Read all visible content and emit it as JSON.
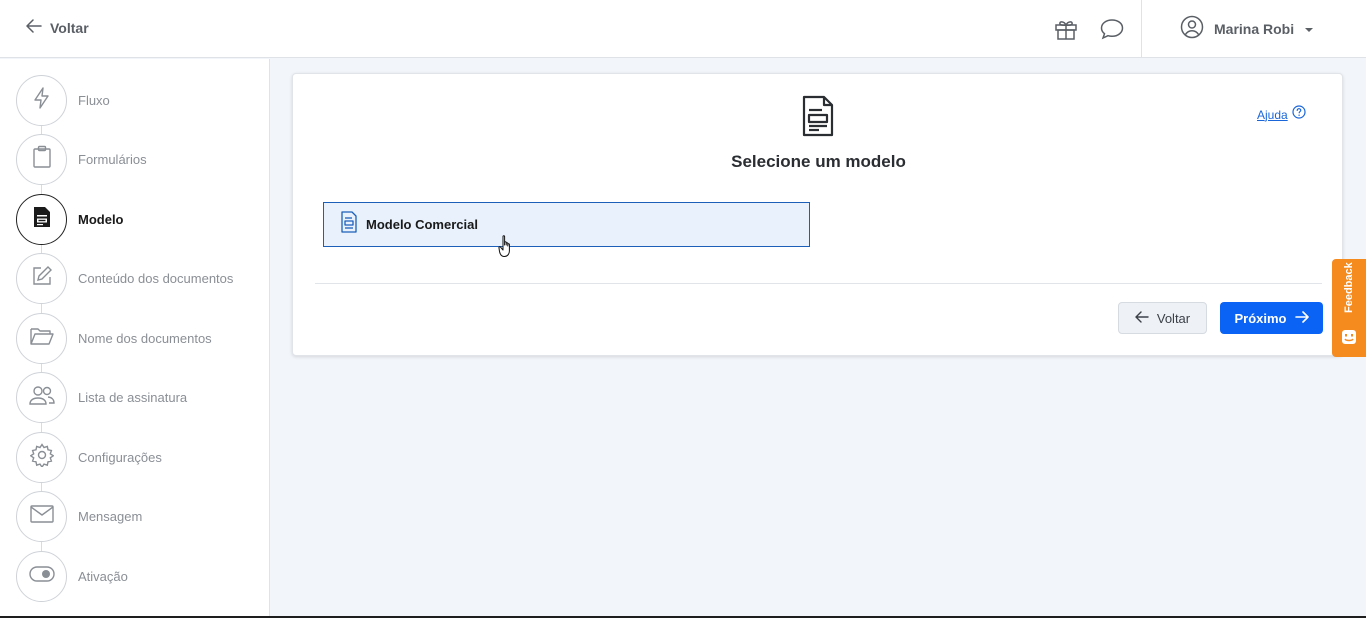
{
  "header": {
    "back_label": "Voltar",
    "user_name": "Marina Robi"
  },
  "steps": [
    {
      "label": "Fluxo",
      "icon": "lightning-icon",
      "active": false
    },
    {
      "label": "Formulários",
      "icon": "clipboard-icon",
      "active": false
    },
    {
      "label": "Modelo",
      "icon": "document-icon",
      "active": true
    },
    {
      "label": "Conteúdo dos documentos",
      "icon": "edit-icon",
      "active": false
    },
    {
      "label": "Nome dos documentos",
      "icon": "folder-icon",
      "active": false
    },
    {
      "label": "Lista de assinatura",
      "icon": "users-icon",
      "active": false
    },
    {
      "label": "Configurações",
      "icon": "gear-icon",
      "active": false
    },
    {
      "label": "Mensagem",
      "icon": "envelope-icon",
      "active": false
    },
    {
      "label": "Ativação",
      "icon": "toggle-icon",
      "active": false
    }
  ],
  "main": {
    "title": "Selecione um modelo",
    "help_label": "Ajuda",
    "model_option": "Modelo Comercial",
    "back_button": "Voltar",
    "next_button": "Próximo"
  },
  "feedback_label": "Feedback",
  "colors": {
    "primary": "#0a63f5",
    "selected_bg": "#e8f1fc",
    "selected_border": "#1b5fb8",
    "feedback": "#f58a1f"
  }
}
